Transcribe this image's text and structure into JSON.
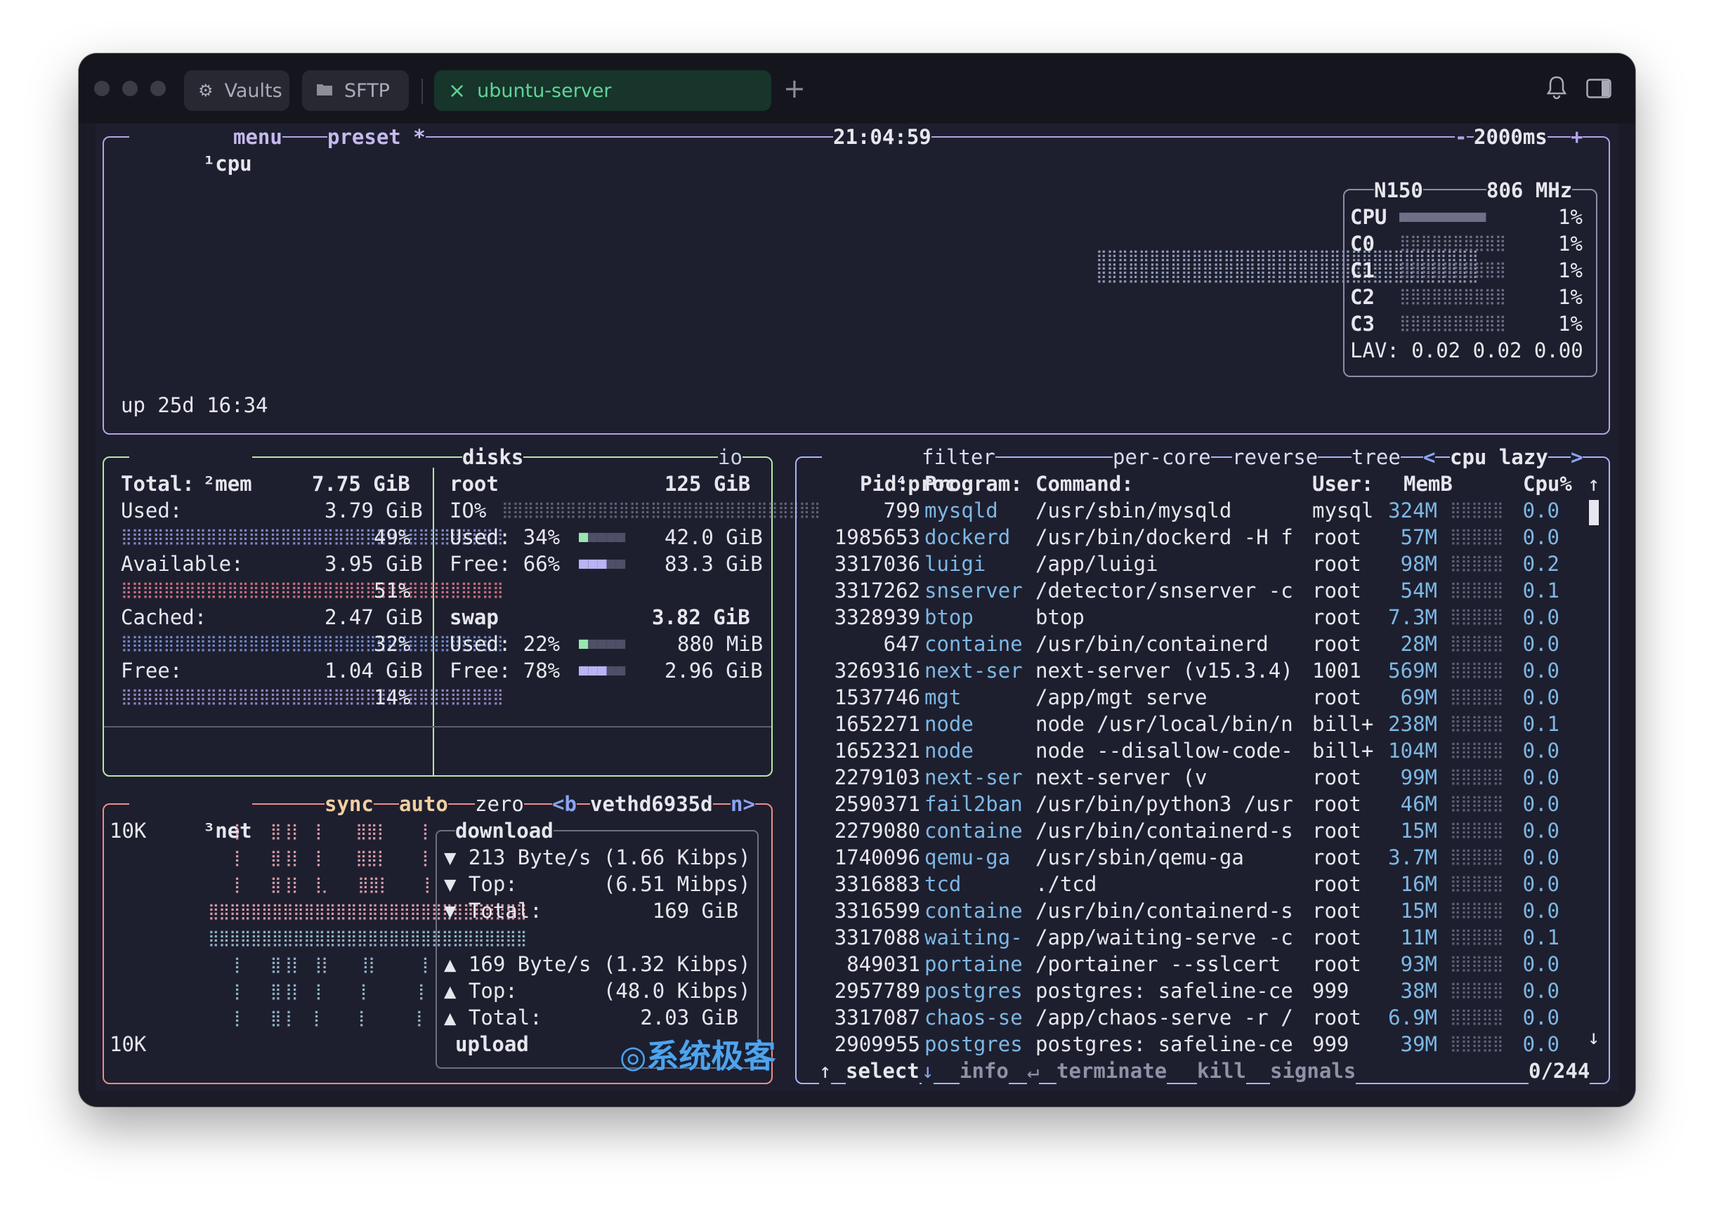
{
  "window": {
    "tabs": [
      {
        "label": "Vaults",
        "icon": "vault-icon"
      },
      {
        "label": "SFTP",
        "icon": "folder-icon"
      },
      {
        "label": "ubuntu-server",
        "icon": "close-icon",
        "active": true
      }
    ],
    "new_tab": "+"
  },
  "cpu": {
    "num": "¹",
    "title": "cpu",
    "menu": "menu",
    "preset": "preset *",
    "clock": "21:04:59",
    "rate_minus": "-",
    "rate": "2000ms",
    "rate_plus": "+",
    "model": "N150",
    "freq": "806 MHz",
    "rows": [
      {
        "label": "CPU",
        "pct": "1%",
        "value": 1
      },
      {
        "label": "C0",
        "pct": "1%",
        "value": 1
      },
      {
        "label": "C1",
        "pct": "1%",
        "value": 1
      },
      {
        "label": "C2",
        "pct": "1%",
        "value": 1
      },
      {
        "label": "C3",
        "pct": "1%",
        "value": 1
      }
    ],
    "lav": "LAV: 0.02 0.02 0.00",
    "uptime": "up 25d 16:34"
  },
  "mem": {
    "num": "²",
    "title": "mem",
    "total_label": "Total:",
    "total_value": "7.75 GiB",
    "items": [
      {
        "label": "Used:",
        "value": "3.79 GiB",
        "pct": "49%",
        "color": "#7f87c9"
      },
      {
        "label": "Available:",
        "value": "3.95 GiB",
        "pct": "51%",
        "color": "#c76f82"
      },
      {
        "label": "Cached:",
        "value": "2.47 GiB",
        "pct": "32%",
        "color": "#6f86c9"
      },
      {
        "label": "Free:",
        "value": "1.04 GiB",
        "pct": "14%",
        "color": "#8f83c3"
      }
    ]
  },
  "disks": {
    "title": "disks",
    "io_label": "io",
    "root_name": "root",
    "root_size": "125 GiB",
    "io_row": "IO%",
    "root_used_label": "Used: 34%",
    "root_used": "42.0 GiB",
    "root_free_label": "Free: 66%",
    "root_free": "83.3 GiB",
    "swap_name": "swap",
    "swap_size": "3.82 GiB",
    "swap_used_label": "Used: 22%",
    "swap_used": "880 MiB",
    "swap_free_label": "Free: 78%",
    "swap_free": "2.96 GiB"
  },
  "net": {
    "num": "³",
    "title": "net",
    "sync": "sync",
    "auto": "auto",
    "zero": "zero",
    "iface_prev": "<b",
    "iface": "vethd6935d",
    "iface_next": "n>",
    "scale_top": "10K",
    "scale_bottom": "10K",
    "download_label": "download",
    "down_rate": "▼ 213 Byte/s (1.66 Kibps)",
    "down_top": "▼ Top:       (6.51 Mibps)",
    "down_total": "▼ Total:         169 GiB",
    "up_rate": "▲ 169 Byte/s (1.32 Kibps)",
    "up_top": "▲ Top:       (48.0 Kibps)",
    "up_total": "▲ Total:        2.03 GiB",
    "upload_label": "upload"
  },
  "proc": {
    "num": "⁴",
    "title": "proc",
    "filter": "filter",
    "per_core": "per-core",
    "reverse": "reverse",
    "tree": "tree",
    "sort_prev": "<",
    "sort": "cpu lazy",
    "sort_next": ">",
    "headers": {
      "pid": "Pid:",
      "program": "Program:",
      "command": "Command:",
      "user": "User:",
      "mem": "MemB",
      "cpu": "Cpu%"
    },
    "rows": [
      {
        "pid": "799",
        "program": "mysqld",
        "command": "/usr/sbin/mysqld",
        "user": "mysql",
        "mem": "324M",
        "cpu": "0.0"
      },
      {
        "pid": "1985653",
        "program": "dockerd",
        "command": "/usr/bin/dockerd -H f",
        "user": "root",
        "mem": "57M",
        "cpu": "0.0"
      },
      {
        "pid": "3317036",
        "program": "luigi",
        "command": "/app/luigi",
        "user": "root",
        "mem": "98M",
        "cpu": "0.2"
      },
      {
        "pid": "3317262",
        "program": "snserver",
        "command": "/detector/snserver -c",
        "user": "root",
        "mem": "54M",
        "cpu": "0.1"
      },
      {
        "pid": "3328939",
        "program": "btop",
        "command": "btop",
        "user": "root",
        "mem": "7.3M",
        "cpu": "0.0"
      },
      {
        "pid": "647",
        "program": "containe",
        "command": "/usr/bin/containerd",
        "user": "root",
        "mem": "28M",
        "cpu": "0.0"
      },
      {
        "pid": "3269316",
        "program": "next-ser",
        "command": "next-server (v15.3.4)",
        "user": "1001",
        "mem": "569M",
        "cpu": "0.0"
      },
      {
        "pid": "1537746",
        "program": "mgt",
        "command": "/app/mgt serve",
        "user": "root",
        "mem": "69M",
        "cpu": "0.0"
      },
      {
        "pid": "1652271",
        "program": "node",
        "command": "node /usr/local/bin/n",
        "user": "bill+",
        "mem": "238M",
        "cpu": "0.1"
      },
      {
        "pid": "1652321",
        "program": "node",
        "command": "node --disallow-code-",
        "user": "bill+",
        "mem": "104M",
        "cpu": "0.0"
      },
      {
        "pid": "2279103",
        "program": "next-ser",
        "command": "next-server (v",
        "user": "root",
        "mem": "99M",
        "cpu": "0.0"
      },
      {
        "pid": "2590371",
        "program": "fail2ban",
        "command": "/usr/bin/python3 /usr",
        "user": "root",
        "mem": "46M",
        "cpu": "0.0"
      },
      {
        "pid": "2279080",
        "program": "containe",
        "command": "/usr/bin/containerd-s",
        "user": "root",
        "mem": "15M",
        "cpu": "0.0"
      },
      {
        "pid": "1740096",
        "program": "qemu-ga",
        "command": "/usr/sbin/qemu-ga",
        "user": "root",
        "mem": "3.7M",
        "cpu": "0.0"
      },
      {
        "pid": "3316883",
        "program": "tcd",
        "command": "./tcd",
        "user": "root",
        "mem": "16M",
        "cpu": "0.0"
      },
      {
        "pid": "3316599",
        "program": "containe",
        "command": "/usr/bin/containerd-s",
        "user": "root",
        "mem": "15M",
        "cpu": "0.0"
      },
      {
        "pid": "3317088",
        "program": "waiting-",
        "command": "/app/waiting-serve -c",
        "user": "root",
        "mem": "11M",
        "cpu": "0.1"
      },
      {
        "pid": "849031",
        "program": "portaine",
        "command": "/portainer --sslcert",
        "user": "root",
        "mem": "93M",
        "cpu": "0.0"
      },
      {
        "pid": "2957789",
        "program": "postgres",
        "command": "postgres: safeline-ce",
        "user": "999",
        "mem": "38M",
        "cpu": "0.0"
      },
      {
        "pid": "3317087",
        "program": "chaos-se",
        "command": "/app/chaos-serve -r /",
        "user": "root",
        "mem": "6.9M",
        "cpu": "0.0"
      },
      {
        "pid": "2909955",
        "program": "postgres",
        "command": "postgres: safeline-ce",
        "user": "999",
        "mem": "39M",
        "cpu": "0.0"
      }
    ],
    "footer": {
      "select_arrow_up": "↑",
      "select": "select",
      "select_arrow_down": "↓",
      "info": "info",
      "enter_symbol": "↵",
      "terminate": "terminate",
      "kill": "kill",
      "signals": "signals",
      "count": "0/244"
    }
  },
  "watermark": "系统极客",
  "colors": {
    "cpu_box": "#b4a2e8",
    "mem_box": "#b8e6a2",
    "net_box": "#f08b8b",
    "proc_box": "#a9b5f8",
    "program_text": "#7cb8e6",
    "active_tab": "#5fd49a"
  }
}
